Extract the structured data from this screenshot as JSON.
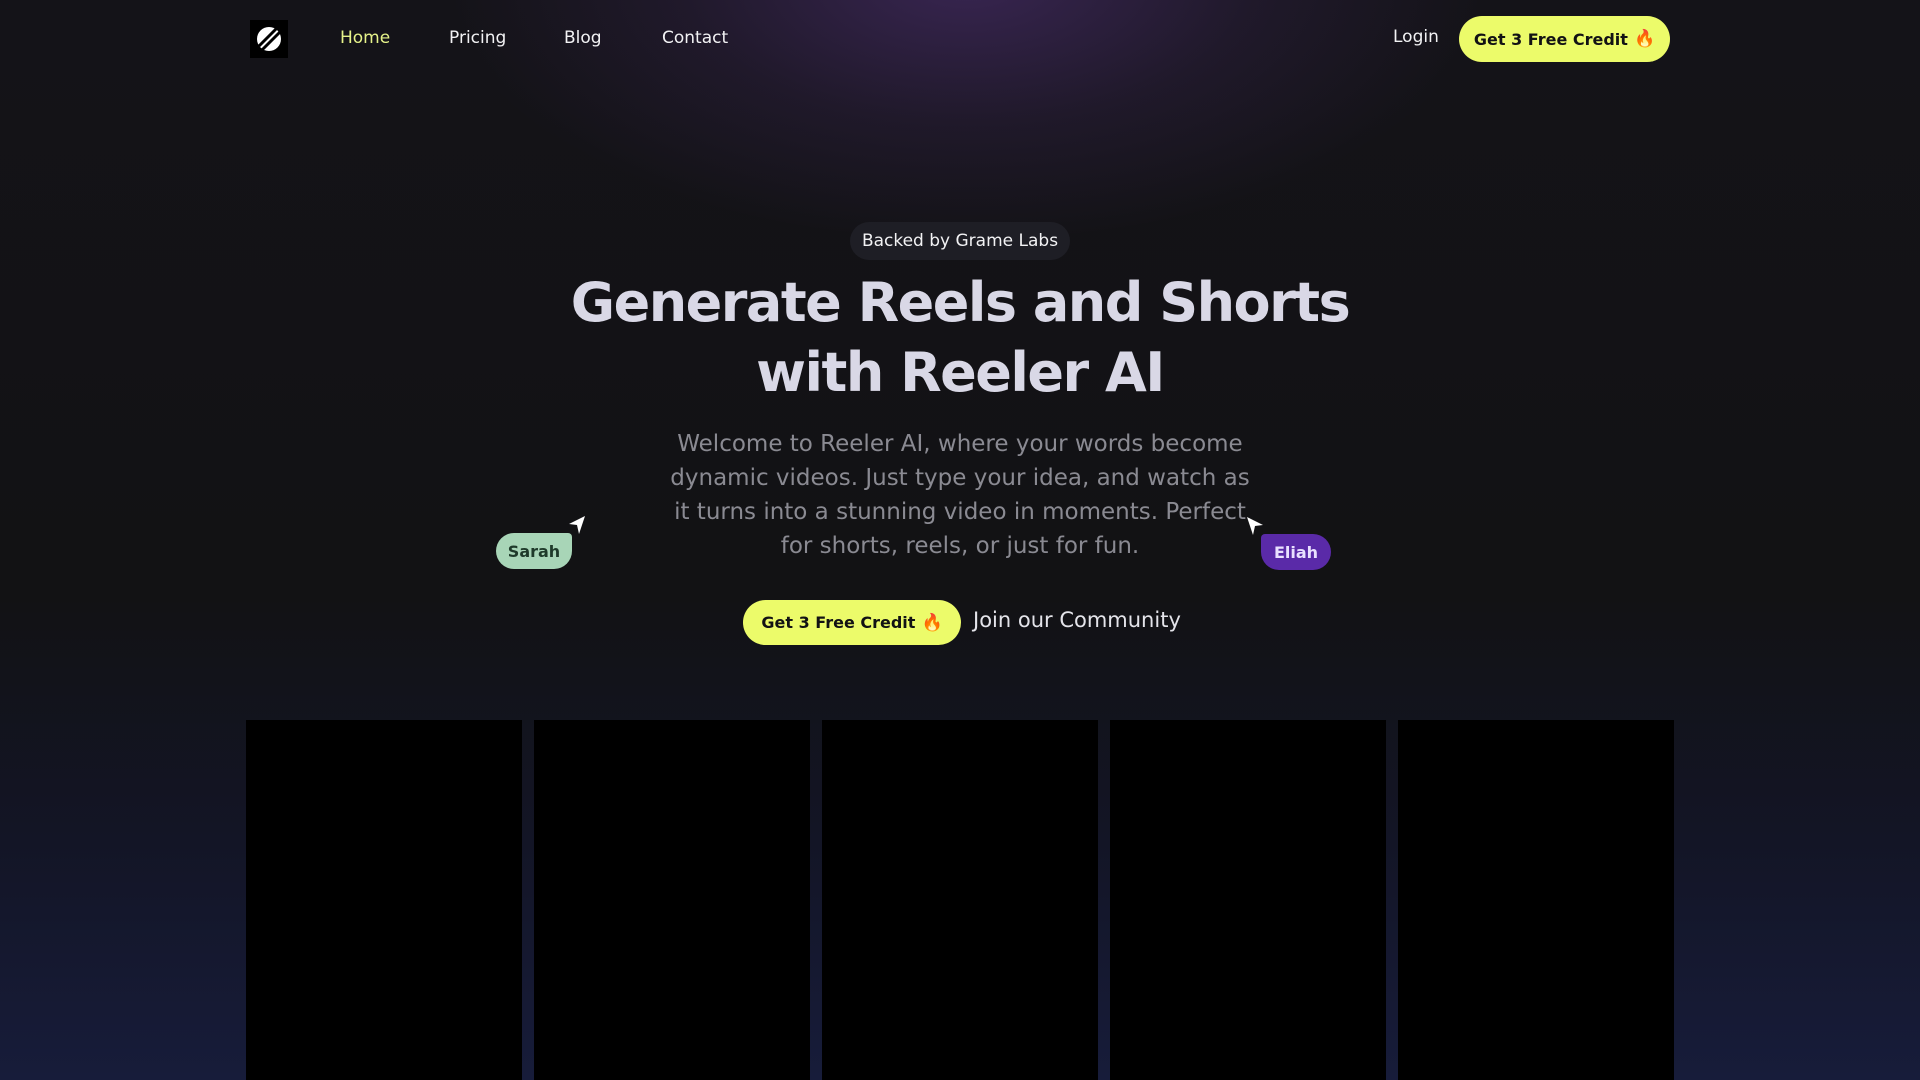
{
  "nav": {
    "logo_icon": "reeler-logo-icon",
    "links": [
      {
        "label": "Home",
        "active": true
      },
      {
        "label": "Pricing",
        "active": false
      },
      {
        "label": "Blog",
        "active": false
      },
      {
        "label": "Contact",
        "active": false
      }
    ],
    "login_label": "Login",
    "cta_label": "Get 3 Free Credit",
    "cta_icon": "flame-icon"
  },
  "hero": {
    "badge": "Backed by Grame Labs",
    "headline_line1": "Generate Reels and Shorts",
    "headline_line2": "with Reeler AI",
    "subtitle": "Welcome to Reeler AI, where your words become dynamic videos. Just type your idea, and watch as it turns into a stunning video in moments. Perfect for shorts, reels, or just for fun.",
    "cta_label": "Get 3 Free Credit",
    "cta_icon": "flame-icon",
    "community_label": "Join our Community",
    "cursor_tags": [
      {
        "name": "Sarah",
        "color": "#a8d5b7"
      },
      {
        "name": "Eliah",
        "color": "#5a2aa8"
      }
    ]
  },
  "videos": {
    "count": 5,
    "card_color": "#000000"
  },
  "colors": {
    "accent": "#ecfb6a",
    "active_nav": "#e6f38a",
    "background": "#121214"
  }
}
